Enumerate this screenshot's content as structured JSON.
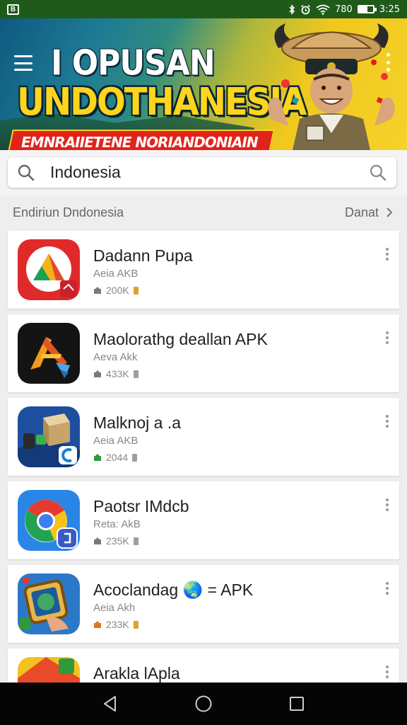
{
  "status_bar": {
    "left_icon": "sim-card-icon",
    "left_label": "B",
    "network": "780",
    "time": "3:25",
    "battery_level": 0.6,
    "icons": [
      "bluetooth-icon",
      "alarm-icon",
      "wifi-icon",
      "battery-icon"
    ]
  },
  "banner": {
    "title_line1": "I OPUSAN",
    "title_line2": "UNDOTHANESIA",
    "ribbon_text": "EMNRAIIETENE NORIANDONIAIN",
    "menu_icon": "hamburger-menu-icon",
    "more_icon": "more-vert-icon"
  },
  "search": {
    "value": "Indonesia",
    "placeholder": "Search"
  },
  "section": {
    "title": "Endiriun Dndonesia",
    "link_label": "Danat"
  },
  "apps": [
    {
      "title": "Dadann Pupa",
      "subtitle": "Aeia AKB",
      "size": "200K",
      "icon": "drive-app-icon",
      "tag_color": "#e0a030"
    },
    {
      "title": "Maolorathg deallan APK",
      "subtitle": "Aeva Akk",
      "size": "433K",
      "icon": "tools-app-icon",
      "tag_color": "#9e9e9e"
    },
    {
      "title": "Malknoj a .a",
      "subtitle": "Aeia AKB",
      "size": "2044",
      "icon": "box-app-icon",
      "tag_color": "#9e9e9e"
    },
    {
      "title": "Paotsr IMdcb",
      "subtitle": "Reta: AkB",
      "size": "235K",
      "icon": "chrome-app-icon",
      "tag_color": "#9e9e9e"
    },
    {
      "title": "Acoclandag 🌏 = APK",
      "subtitle": "Aeia Akh",
      "size": "233K",
      "icon": "globe-app-icon",
      "tag_color": "#e0a030"
    },
    {
      "title": "Araklа lApla",
      "subtitle": "",
      "size": "",
      "icon": "partial-app-icon",
      "tag_color": "#9e9e9e"
    }
  ],
  "nav": {
    "back": "back-icon",
    "home": "home-icon",
    "recents": "recents-icon"
  }
}
